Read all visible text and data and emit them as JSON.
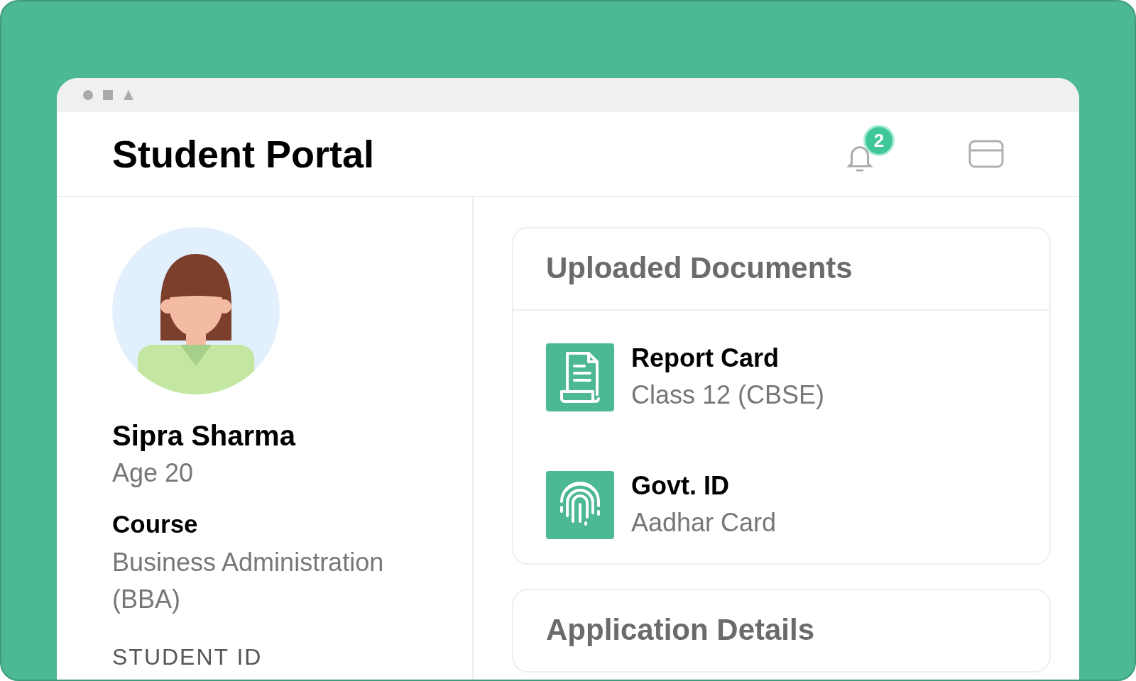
{
  "window": {
    "title": "Student Portal",
    "notifications": {
      "count": "2"
    }
  },
  "profile": {
    "name": "Sipra Sharma",
    "age": "Age 20",
    "course_label": "Course",
    "course": "Business Administration (BBA)",
    "student_id_label": "STUDENT ID"
  },
  "documents": {
    "title": "Uploaded Documents",
    "items": [
      {
        "kind": "document",
        "title": "Report Card",
        "subtitle": "Class 12 (CBSE)"
      },
      {
        "kind": "fingerprint",
        "title": "Govt. ID",
        "subtitle": "Aadhar Card"
      }
    ]
  },
  "application": {
    "title": "Application Details"
  }
}
